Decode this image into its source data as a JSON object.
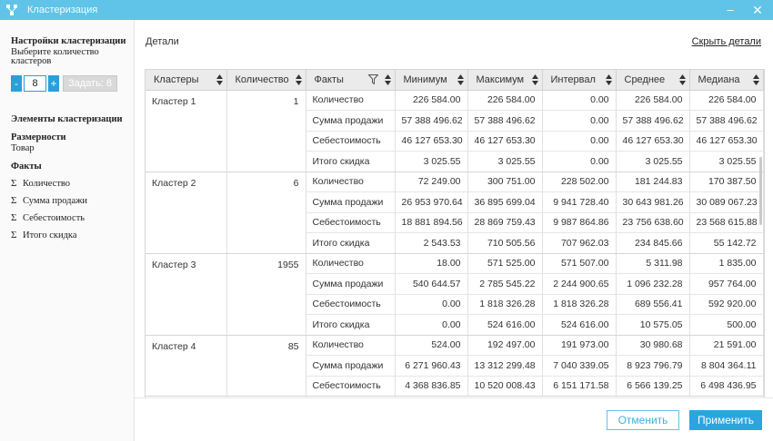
{
  "window": {
    "title": "Кластеризация",
    "minimize": "–",
    "close": "✕"
  },
  "sidebar": {
    "settings_heading": "Настройки кластеризации",
    "settings_hint_line1": "Выберите количество",
    "settings_hint_line2": "кластеров",
    "stepper": {
      "minus": "-",
      "value": "8",
      "plus": "+",
      "set_label": "Задать: 8"
    },
    "elements_heading": "Элементы кластеризации",
    "dimensions_heading": "Размерности",
    "dimension": "Товар",
    "facts_heading": "Факты",
    "facts": [
      "Количество",
      "Сумма продажи",
      "Себестоимость",
      "Итого скидка"
    ]
  },
  "main": {
    "title": "Детали",
    "hide_link": "Скрыть детали",
    "columns": [
      "Кластеры",
      "Количество",
      "Факты",
      "Минимум",
      "Максимум",
      "Интервал",
      "Среднее",
      "Медиана"
    ],
    "groups": [
      {
        "cluster": "Кластер 1",
        "count": "1",
        "rows": [
          {
            "fact": "Количество",
            "min": "226 584.00",
            "max": "226 584.00",
            "interval": "0.00",
            "avg": "226 584.00",
            "median": "226 584.00"
          },
          {
            "fact": "Сумма продажи",
            "min": "57 388 496.62",
            "max": "57 388 496.62",
            "interval": "0.00",
            "avg": "57 388 496.62",
            "median": "57 388 496.62"
          },
          {
            "fact": "Себестоимость",
            "min": "46 127 653.30",
            "max": "46 127 653.30",
            "interval": "0.00",
            "avg": "46 127 653.30",
            "median": "46 127 653.30"
          },
          {
            "fact": "Итого скидка",
            "min": "3 025.55",
            "max": "3 025.55",
            "interval": "0.00",
            "avg": "3 025.55",
            "median": "3 025.55"
          }
        ]
      },
      {
        "cluster": "Кластер 2",
        "count": "6",
        "rows": [
          {
            "fact": "Количество",
            "min": "72 249.00",
            "max": "300 751.00",
            "interval": "228 502.00",
            "avg": "181 244.83",
            "median": "170 387.50"
          },
          {
            "fact": "Сумма продажи",
            "min": "26 953 970.64",
            "max": "36 895 699.04",
            "interval": "9 941 728.40",
            "avg": "30 643 981.26",
            "median": "30 089 067.23"
          },
          {
            "fact": "Себестоимость",
            "min": "18 881 894.56",
            "max": "28 869 759.43",
            "interval": "9 987 864.86",
            "avg": "23 756 638.60",
            "median": "23 568 615.88"
          },
          {
            "fact": "Итого скидка",
            "min": "2 543.53",
            "max": "710 505.56",
            "interval": "707 962.03",
            "avg": "234 845.66",
            "median": "55 142.72"
          }
        ]
      },
      {
        "cluster": "Кластер 3",
        "count": "1955",
        "rows": [
          {
            "fact": "Количество",
            "min": "18.00",
            "max": "571 525.00",
            "interval": "571 507.00",
            "avg": "5 311.98",
            "median": "1 835.00"
          },
          {
            "fact": "Сумма продажи",
            "min": "540 644.57",
            "max": "2 785 545.22",
            "interval": "2 244 900.65",
            "avg": "1 096 232.28",
            "median": "957 764.00"
          },
          {
            "fact": "Себестоимость",
            "min": "0.00",
            "max": "1 818 326.28",
            "interval": "1 818 326.28",
            "avg": "689 556.41",
            "median": "592 920.00"
          },
          {
            "fact": "Итого скидка",
            "min": "0.00",
            "max": "524 616.00",
            "interval": "524 616.00",
            "avg": "10 575.05",
            "median": "500.00"
          }
        ]
      },
      {
        "cluster": "Кластер 4",
        "count": "85",
        "rows": [
          {
            "fact": "Количество",
            "min": "524.00",
            "max": "192 497.00",
            "interval": "191 973.00",
            "avg": "30 980.68",
            "median": "21 591.00"
          },
          {
            "fact": "Сумма продажи",
            "min": "6 271 960.43",
            "max": "13 312 299.48",
            "interval": "7 040 339.05",
            "avg": "8 923 796.79",
            "median": "8 804 364.11"
          },
          {
            "fact": "Себестоимость",
            "min": "4 368 836.85",
            "max": "10 520 008.43",
            "interval": "6 151 171.58",
            "avg": "6 566 139.25",
            "median": "6 498 436.95"
          }
        ]
      }
    ]
  },
  "footer": {
    "cancel": "Отменить",
    "apply": "Применить"
  },
  "colors": {
    "titlebar": "#5fc4e8",
    "accent": "#2ba5e0"
  }
}
